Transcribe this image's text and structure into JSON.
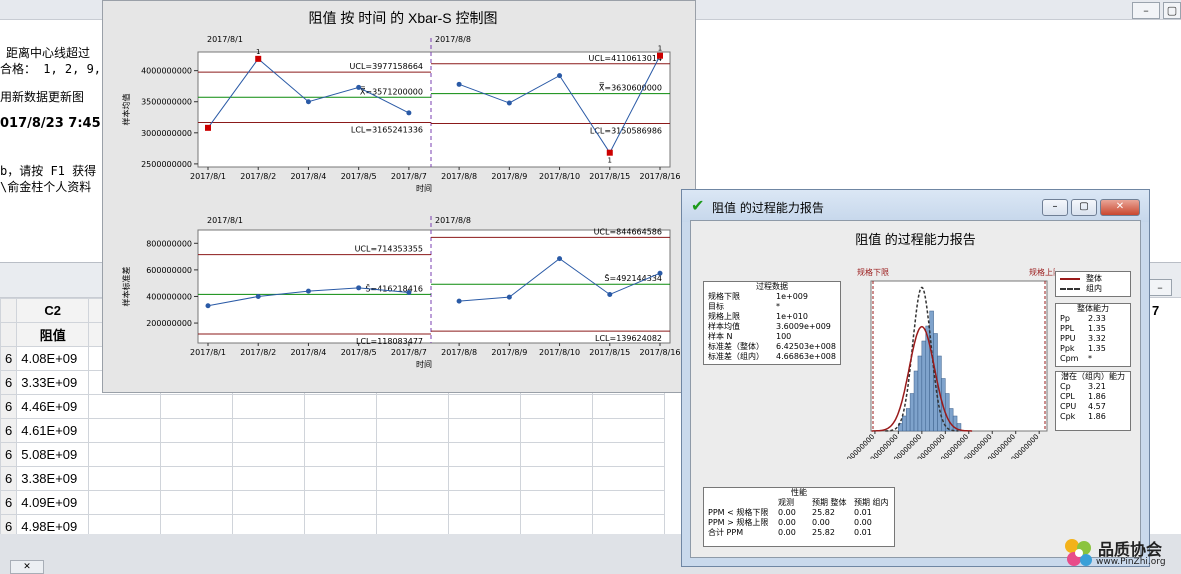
{
  "session": {
    "lines": [
      "距离中心线超过",
      "合格： 1, 2, 9,",
      "用新数据更新图",
      "017/8/23 7:45:",
      "b，请按 F1 获得",
      "\\俞金柱个人资料"
    ]
  },
  "worksheet": {
    "col_id": "C2",
    "col_id_right": "7",
    "col_name": "阻值",
    "row_prefix": "6",
    "values": [
      "4.08E+09",
      "3.33E+09",
      "4.46E+09",
      "4.61E+09",
      "5.08E+09",
      "3.38E+09",
      "4.09E+09",
      "4.98E+09"
    ]
  },
  "xbar_window": {
    "title": "阻值 按 时间 的 Xbar-S 控制图",
    "x_axis_label": "时间",
    "stage_labels": [
      "2017/8/1",
      "2017/8/8"
    ],
    "x_ticks": [
      "2017/8/1",
      "2017/8/2",
      "2017/8/4",
      "2017/8/5",
      "2017/8/7",
      "2017/8/8",
      "2017/8/9",
      "2017/8/10",
      "2017/8/15",
      "2017/8/16"
    ],
    "xbar": {
      "ylabel": "样本均值",
      "yticks": [
        "4000000000",
        "3500000000",
        "3000000000",
        "2500000000"
      ],
      "ytick_values": [
        4000000000,
        3500000000,
        3000000000,
        2500000000
      ],
      "stage1_labels": {
        "ucl": "UCL=3977158664",
        "center": "X̿=3571200000",
        "lcl": "LCL=3165241336"
      },
      "stage2_labels": {
        "ucl": "UCL=4110613014",
        "center": "X̿=3630600000",
        "lcl": "LCL=3150586986"
      },
      "flag_labels": [
        "1",
        "1",
        "1"
      ]
    },
    "s": {
      "ylabel": "样本标准差",
      "yticks": [
        "800000000",
        "600000000",
        "400000000",
        "200000000"
      ],
      "ytick_values": [
        800000000,
        600000000,
        400000000,
        200000000
      ],
      "stage1_labels": {
        "ucl": "UCL=714353355",
        "center": "S̄=416218416",
        "lcl": "LCL=118083477"
      },
      "stage2_labels": {
        "ucl": "UCL=844664586",
        "center": "S̄=492144334",
        "lcl": "LCL=139624082"
      }
    }
  },
  "chart_data": [
    {
      "type": "line",
      "title": "阻值 按 时间 的 Xbar-S 控制图",
      "ylabel": "样本均值",
      "xlabel": "时间",
      "ylim": [
        2450000000,
        4300000000
      ],
      "categories": [
        "2017/8/1",
        "2017/8/2",
        "2017/8/4",
        "2017/8/5",
        "2017/8/7",
        "2017/8/8",
        "2017/8/9",
        "2017/8/10",
        "2017/8/15",
        "2017/8/16"
      ],
      "values": [
        3080000000,
        4190000000,
        3500000000,
        3730000000,
        3320000000,
        3780000000,
        3480000000,
        3920000000,
        2680000000,
        4240000000
      ],
      "out_of_control": [
        0,
        1,
        8,
        9
      ],
      "stages": [
        {
          "from": 0,
          "to": 4,
          "ucl": 3977158664,
          "center": 3571200000,
          "lcl": 3165241336
        },
        {
          "from": 5,
          "to": 9,
          "ucl": 4110613014,
          "center": 3630600000,
          "lcl": 3150586986
        }
      ]
    },
    {
      "type": "line",
      "ylabel": "样本标准差",
      "xlabel": "时间",
      "ylim": [
        50000000,
        900000000
      ],
      "categories": [
        "2017/8/1",
        "2017/8/2",
        "2017/8/4",
        "2017/8/5",
        "2017/8/7",
        "2017/8/8",
        "2017/8/9",
        "2017/8/10",
        "2017/8/15",
        "2017/8/16"
      ],
      "values": [
        330000000,
        400000000,
        440000000,
        465000000,
        430000000,
        365000000,
        395000000,
        685000000,
        415000000,
        575000000
      ],
      "stages": [
        {
          "from": 0,
          "to": 4,
          "ucl": 714353355,
          "center": 416218416,
          "lcl": 118083477
        },
        {
          "from": 5,
          "to": 9,
          "ucl": 844664586,
          "center": 492144334,
          "lcl": 139624082
        }
      ]
    },
    {
      "type": "bar",
      "title": "阻值 的过程能力报告",
      "x_ticks": [
        "1200000000",
        "2400000000",
        "3600000000",
        "4800000000",
        "6000000000",
        "7200000000",
        "8400000000",
        "9600000000"
      ],
      "x_tick_values": [
        1200000000,
        2400000000,
        3600000000,
        4800000000,
        6000000000,
        7200000000,
        8400000000,
        9600000000
      ],
      "xlim": [
        1000000000,
        10000000000
      ],
      "bins_start": 2400000000,
      "bin_width": 200000000,
      "counts": [
        1,
        2,
        3,
        5,
        8,
        10,
        12,
        14,
        16,
        13,
        10,
        7,
        5,
        3,
        2,
        1
      ],
      "lsl": 1000000000,
      "usl": 10000000000,
      "mean": 3600900000,
      "sd_overall": 642503000,
      "sd_within": 466863000,
      "marker_labels": {
        "lsl": "规格下限",
        "usl": "规格上限"
      },
      "legend": [
        "整体",
        "组内"
      ]
    }
  ],
  "capability_window": {
    "title": "阻值 的过程能力报告",
    "report_title": "阻值 的过程能力报告",
    "process_data": {
      "heading": "过程数据",
      "rows": [
        {
          "k": "规格下限",
          "v": "1e+009"
        },
        {
          "k": "目标",
          "v": "*"
        },
        {
          "k": "规格上限",
          "v": "1e+010"
        },
        {
          "k": "样本均值",
          "v": "3.6009e+009"
        },
        {
          "k": "样本 N",
          "v": "100"
        },
        {
          "k": "标准差（整体）",
          "v": "6.42503e+008"
        },
        {
          "k": "标准差（组内）",
          "v": "4.66863e+008"
        }
      ]
    },
    "overall_capability": {
      "heading": "整体能力",
      "rows": [
        {
          "k": "Pp",
          "v": "2.33"
        },
        {
          "k": "PPL",
          "v": "1.35"
        },
        {
          "k": "PPU",
          "v": "3.32"
        },
        {
          "k": "Ppk",
          "v": "1.35"
        },
        {
          "k": "Cpm",
          "v": "*"
        }
      ]
    },
    "potential_capability": {
      "heading": "潜在（组内）能力",
      "rows": [
        {
          "k": "Cp",
          "v": "3.21"
        },
        {
          "k": "CPL",
          "v": "1.86"
        },
        {
          "k": "CPU",
          "v": "4.57"
        },
        {
          "k": "Cpk",
          "v": "1.86"
        }
      ]
    },
    "performance": {
      "heading": "性能",
      "col_headers": [
        "观测",
        "预期 整体",
        "预期 组内"
      ],
      "rows": [
        {
          "k": "PPM < 规格下限",
          "v": [
            "0.00",
            "25.82",
            "0.01"
          ]
        },
        {
          "k": "PPM > 规格上限",
          "v": [
            "0.00",
            "0.00",
            "0.00"
          ]
        },
        {
          "k": "合计 PPM",
          "v": [
            "0.00",
            "25.82",
            "0.01"
          ]
        }
      ]
    }
  },
  "logo": {
    "name": "品质协会",
    "url": "www.PinZhi.org"
  },
  "colors": {
    "data_line": "#2a5aa6",
    "center": "#0a8a0a",
    "limit": "#8b1a1a",
    "flag": "#cc0000",
    "hist_bar": "#7fa3cc",
    "curve_overall": "#9a1b1b"
  }
}
